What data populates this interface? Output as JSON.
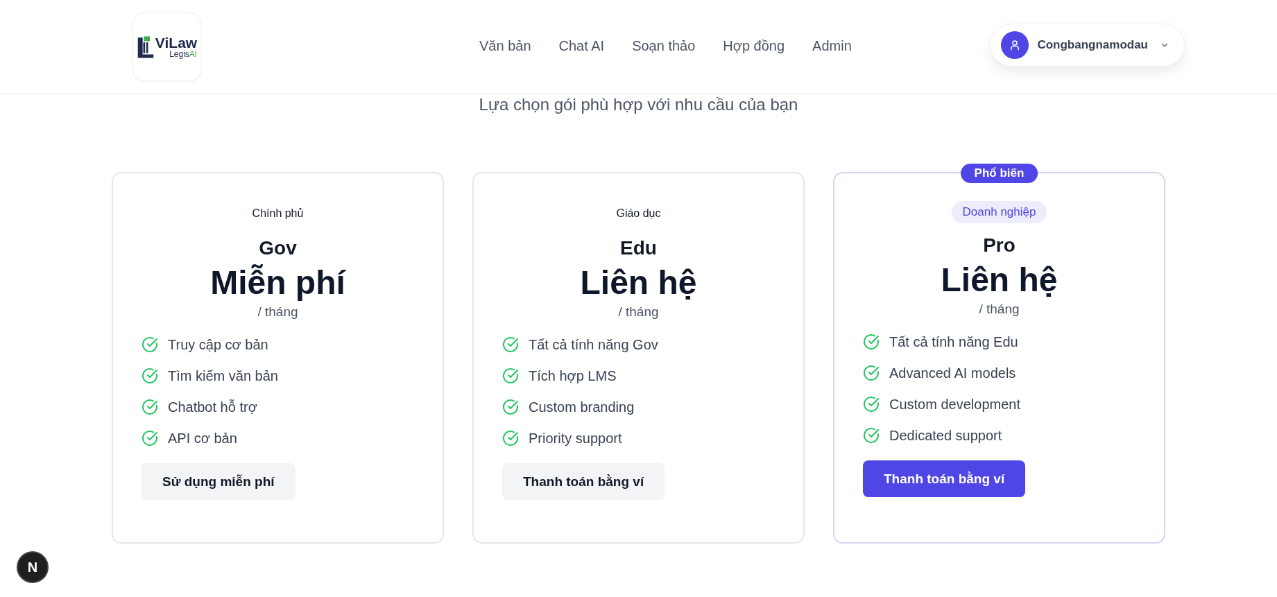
{
  "header": {
    "logo": {
      "name": "ViLaw",
      "tagline_main": "Legis",
      "tagline_accent": "AI"
    },
    "nav": [
      {
        "label": "Văn bản"
      },
      {
        "label": "Chat AI"
      },
      {
        "label": "Soạn thảo"
      },
      {
        "label": "Hợp đồng"
      },
      {
        "label": "Admin"
      }
    ],
    "user": {
      "name": "Congbangnamodau"
    }
  },
  "subtitle": "Lựa chọn gói phù hợp với nhu cầu của bạn",
  "plans": [
    {
      "category": "Chính phủ",
      "name": "Gov",
      "price": "Miễn phí",
      "period": "/ tháng",
      "highlighted": false,
      "features": [
        "Truy cập cơ bản",
        "Tìm kiếm văn bản",
        "Chatbot hỗ trợ",
        "API cơ bản"
      ],
      "button": {
        "label": "Sử dụng miễn phí",
        "kind": "secondary"
      }
    },
    {
      "category": "Giáo dục",
      "name": "Edu",
      "price": "Liên hệ",
      "period": "/ tháng",
      "highlighted": false,
      "features": [
        "Tất cả tính năng Gov",
        "Tích hợp LMS",
        "Custom branding",
        "Priority support"
      ],
      "button": {
        "label": "Thanh toán bằng ví",
        "kind": "secondary"
      }
    },
    {
      "category": "Doanh nghiệp",
      "name": "Pro",
      "price": "Liên hệ",
      "period": "/ tháng",
      "highlighted": true,
      "badge": "Phổ biến",
      "features": [
        "Tất cả tính năng Edu",
        "Advanced AI models",
        "Custom development",
        "Dedicated support"
      ],
      "button": {
        "label": "Thanh toán bằng ví",
        "kind": "primary"
      }
    }
  ],
  "dev_badge": {
    "letter": "N"
  }
}
